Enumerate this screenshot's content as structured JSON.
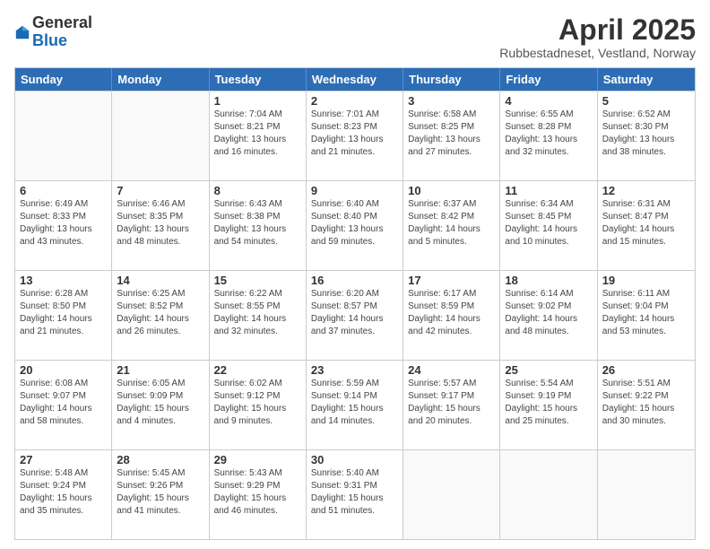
{
  "logo": {
    "general": "General",
    "blue": "Blue"
  },
  "header": {
    "month": "April 2025",
    "location": "Rubbestadneset, Vestland, Norway"
  },
  "weekdays": [
    "Sunday",
    "Monday",
    "Tuesday",
    "Wednesday",
    "Thursday",
    "Friday",
    "Saturday"
  ],
  "weeks": [
    [
      {
        "day": "",
        "info": ""
      },
      {
        "day": "",
        "info": ""
      },
      {
        "day": "1",
        "info": "Sunrise: 7:04 AM\nSunset: 8:21 PM\nDaylight: 13 hours and 16 minutes."
      },
      {
        "day": "2",
        "info": "Sunrise: 7:01 AM\nSunset: 8:23 PM\nDaylight: 13 hours and 21 minutes."
      },
      {
        "day": "3",
        "info": "Sunrise: 6:58 AM\nSunset: 8:25 PM\nDaylight: 13 hours and 27 minutes."
      },
      {
        "day": "4",
        "info": "Sunrise: 6:55 AM\nSunset: 8:28 PM\nDaylight: 13 hours and 32 minutes."
      },
      {
        "day": "5",
        "info": "Sunrise: 6:52 AM\nSunset: 8:30 PM\nDaylight: 13 hours and 38 minutes."
      }
    ],
    [
      {
        "day": "6",
        "info": "Sunrise: 6:49 AM\nSunset: 8:33 PM\nDaylight: 13 hours and 43 minutes."
      },
      {
        "day": "7",
        "info": "Sunrise: 6:46 AM\nSunset: 8:35 PM\nDaylight: 13 hours and 48 minutes."
      },
      {
        "day": "8",
        "info": "Sunrise: 6:43 AM\nSunset: 8:38 PM\nDaylight: 13 hours and 54 minutes."
      },
      {
        "day": "9",
        "info": "Sunrise: 6:40 AM\nSunset: 8:40 PM\nDaylight: 13 hours and 59 minutes."
      },
      {
        "day": "10",
        "info": "Sunrise: 6:37 AM\nSunset: 8:42 PM\nDaylight: 14 hours and 5 minutes."
      },
      {
        "day": "11",
        "info": "Sunrise: 6:34 AM\nSunset: 8:45 PM\nDaylight: 14 hours and 10 minutes."
      },
      {
        "day": "12",
        "info": "Sunrise: 6:31 AM\nSunset: 8:47 PM\nDaylight: 14 hours and 15 minutes."
      }
    ],
    [
      {
        "day": "13",
        "info": "Sunrise: 6:28 AM\nSunset: 8:50 PM\nDaylight: 14 hours and 21 minutes."
      },
      {
        "day": "14",
        "info": "Sunrise: 6:25 AM\nSunset: 8:52 PM\nDaylight: 14 hours and 26 minutes."
      },
      {
        "day": "15",
        "info": "Sunrise: 6:22 AM\nSunset: 8:55 PM\nDaylight: 14 hours and 32 minutes."
      },
      {
        "day": "16",
        "info": "Sunrise: 6:20 AM\nSunset: 8:57 PM\nDaylight: 14 hours and 37 minutes."
      },
      {
        "day": "17",
        "info": "Sunrise: 6:17 AM\nSunset: 8:59 PM\nDaylight: 14 hours and 42 minutes."
      },
      {
        "day": "18",
        "info": "Sunrise: 6:14 AM\nSunset: 9:02 PM\nDaylight: 14 hours and 48 minutes."
      },
      {
        "day": "19",
        "info": "Sunrise: 6:11 AM\nSunset: 9:04 PM\nDaylight: 14 hours and 53 minutes."
      }
    ],
    [
      {
        "day": "20",
        "info": "Sunrise: 6:08 AM\nSunset: 9:07 PM\nDaylight: 14 hours and 58 minutes."
      },
      {
        "day": "21",
        "info": "Sunrise: 6:05 AM\nSunset: 9:09 PM\nDaylight: 15 hours and 4 minutes."
      },
      {
        "day": "22",
        "info": "Sunrise: 6:02 AM\nSunset: 9:12 PM\nDaylight: 15 hours and 9 minutes."
      },
      {
        "day": "23",
        "info": "Sunrise: 5:59 AM\nSunset: 9:14 PM\nDaylight: 15 hours and 14 minutes."
      },
      {
        "day": "24",
        "info": "Sunrise: 5:57 AM\nSunset: 9:17 PM\nDaylight: 15 hours and 20 minutes."
      },
      {
        "day": "25",
        "info": "Sunrise: 5:54 AM\nSunset: 9:19 PM\nDaylight: 15 hours and 25 minutes."
      },
      {
        "day": "26",
        "info": "Sunrise: 5:51 AM\nSunset: 9:22 PM\nDaylight: 15 hours and 30 minutes."
      }
    ],
    [
      {
        "day": "27",
        "info": "Sunrise: 5:48 AM\nSunset: 9:24 PM\nDaylight: 15 hours and 35 minutes."
      },
      {
        "day": "28",
        "info": "Sunrise: 5:45 AM\nSunset: 9:26 PM\nDaylight: 15 hours and 41 minutes."
      },
      {
        "day": "29",
        "info": "Sunrise: 5:43 AM\nSunset: 9:29 PM\nDaylight: 15 hours and 46 minutes."
      },
      {
        "day": "30",
        "info": "Sunrise: 5:40 AM\nSunset: 9:31 PM\nDaylight: 15 hours and 51 minutes."
      },
      {
        "day": "",
        "info": ""
      },
      {
        "day": "",
        "info": ""
      },
      {
        "day": "",
        "info": ""
      }
    ]
  ]
}
